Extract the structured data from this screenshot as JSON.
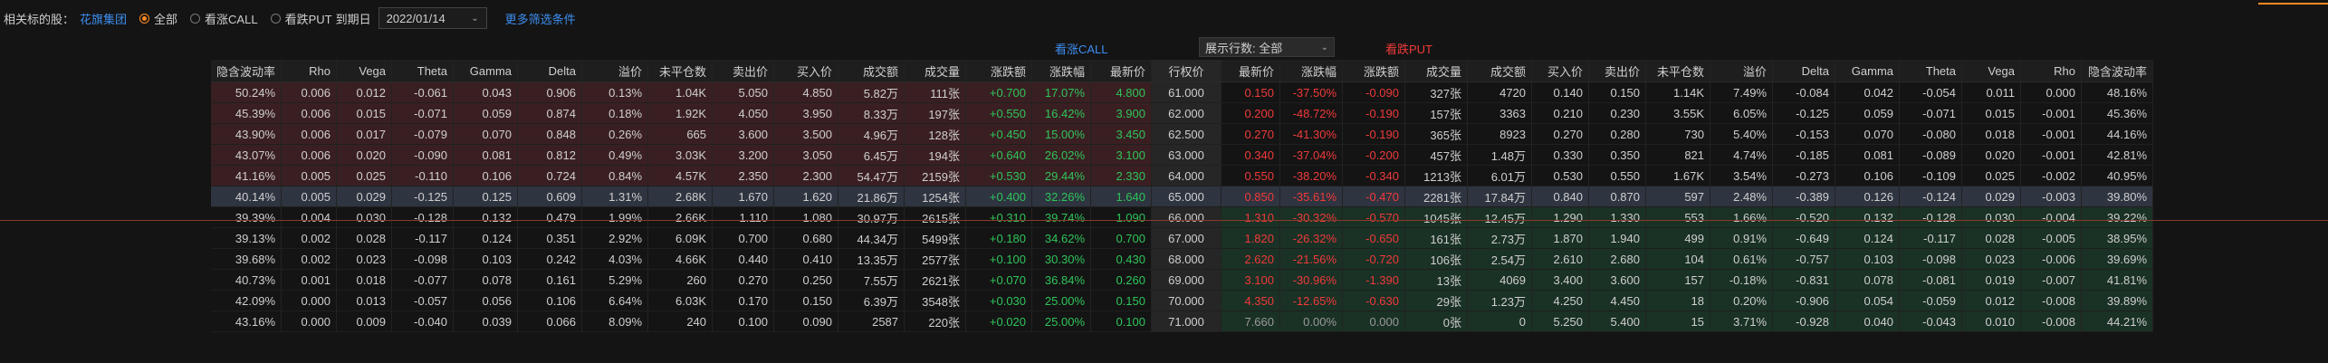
{
  "toolbar": {
    "underlying_label": "相关标的股：",
    "underlying_name": "花旗集团",
    "radios": [
      {
        "label": "全部",
        "selected": true
      },
      {
        "label": "看涨CALL",
        "selected": false
      },
      {
        "label": "看跌PUT",
        "selected": false
      }
    ],
    "expiry_label": "到期日",
    "expiry_value": "2022/01/14",
    "more_filters": "更多筛选条件"
  },
  "band": {
    "call_title": "看涨CALL",
    "put_title": "看跌PUT",
    "rowcount_label": "展示行数: 全部"
  },
  "colors": {
    "accent": "#ff8a1f",
    "up": "#2fc45a",
    "down": "#ef3a3a",
    "link": "#3d8ef0"
  },
  "headers": {
    "call": [
      "隐含波动率",
      "Rho",
      "Vega",
      "Theta",
      "Gamma",
      "Delta",
      "溢价",
      "未平仓数",
      "卖出价",
      "买入价",
      "成交额",
      "成交量",
      "涨跌额",
      "涨跌幅",
      "最新价"
    ],
    "strike": "行权价",
    "put": [
      "最新价",
      "涨跌幅",
      "涨跌额",
      "成交量",
      "成交额",
      "买入价",
      "卖出价",
      "未平仓数",
      "溢价",
      "Delta",
      "Gamma",
      "Theta",
      "Vega",
      "Rho",
      "隐含波动率"
    ]
  },
  "rows": [
    {
      "zone": "itm-call",
      "strike": "61.000",
      "call": [
        "50.24%",
        "0.006",
        "0.012",
        "-0.061",
        "0.043",
        "0.906",
        "0.13%",
        "1.04K",
        "5.050",
        "4.850",
        "5.82万",
        "111张",
        "+0.700",
        "17.07%",
        "4.800"
      ],
      "put": [
        "0.150",
        "-37.50%",
        "-0.090",
        "327张",
        "4720",
        "0.140",
        "0.150",
        "1.14K",
        "7.49%",
        "-0.084",
        "0.042",
        "-0.054",
        "0.011",
        "0.000",
        "48.16%"
      ]
    },
    {
      "zone": "itm-call",
      "strike": "62.000",
      "call": [
        "45.39%",
        "0.006",
        "0.015",
        "-0.071",
        "0.059",
        "0.874",
        "0.18%",
        "1.92K",
        "4.050",
        "3.950",
        "8.33万",
        "197张",
        "+0.550",
        "16.42%",
        "3.900"
      ],
      "put": [
        "0.200",
        "-48.72%",
        "-0.190",
        "157张",
        "3363",
        "0.210",
        "0.230",
        "3.55K",
        "6.05%",
        "-0.125",
        "0.059",
        "-0.071",
        "0.015",
        "-0.001",
        "45.36%"
      ]
    },
    {
      "zone": "itm-call",
      "strike": "62.500",
      "call": [
        "43.90%",
        "0.006",
        "0.017",
        "-0.079",
        "0.070",
        "0.848",
        "0.26%",
        "665",
        "3.600",
        "3.500",
        "4.96万",
        "128张",
        "+0.450",
        "15.00%",
        "3.450"
      ],
      "put": [
        "0.270",
        "-41.30%",
        "-0.190",
        "365张",
        "8923",
        "0.270",
        "0.280",
        "730",
        "5.40%",
        "-0.153",
        "0.070",
        "-0.080",
        "0.018",
        "-0.001",
        "44.16%"
      ]
    },
    {
      "zone": "itm-call",
      "strike": "63.000",
      "call": [
        "43.07%",
        "0.006",
        "0.020",
        "-0.090",
        "0.081",
        "0.812",
        "0.49%",
        "3.03K",
        "3.200",
        "3.050",
        "6.45万",
        "194张",
        "+0.640",
        "26.02%",
        "3.100"
      ],
      "put": [
        "0.340",
        "-37.04%",
        "-0.200",
        "457张",
        "1.48万",
        "0.330",
        "0.350",
        "821",
        "4.74%",
        "-0.185",
        "0.081",
        "-0.089",
        "0.020",
        "-0.001",
        "42.81%"
      ]
    },
    {
      "zone": "itm-call",
      "strike": "64.000",
      "call": [
        "41.16%",
        "0.005",
        "0.025",
        "-0.110",
        "0.106",
        "0.724",
        "0.84%",
        "4.57K",
        "2.350",
        "2.300",
        "54.47万",
        "2159张",
        "+0.530",
        "29.44%",
        "2.330"
      ],
      "put": [
        "0.550",
        "-38.20%",
        "-0.340",
        "1213张",
        "6.01万",
        "0.530",
        "0.550",
        "1.67K",
        "3.54%",
        "-0.273",
        "0.106",
        "-0.109",
        "0.025",
        "-0.002",
        "40.95%"
      ]
    },
    {
      "zone": "atm",
      "strike": "65.000",
      "call": [
        "40.14%",
        "0.005",
        "0.029",
        "-0.125",
        "0.125",
        "0.609",
        "1.31%",
        "2.68K",
        "1.670",
        "1.620",
        "21.86万",
        "1254张",
        "+0.400",
        "32.26%",
        "1.640"
      ],
      "put": [
        "0.850",
        "-35.61%",
        "-0.470",
        "2281张",
        "17.84万",
        "0.840",
        "0.870",
        "597",
        "2.48%",
        "-0.389",
        "0.126",
        "-0.124",
        "0.029",
        "-0.003",
        "39.80%"
      ]
    },
    {
      "zone": "itm-put",
      "strike": "66.000",
      "call": [
        "39.39%",
        "0.004",
        "0.030",
        "-0.128",
        "0.132",
        "0.479",
        "1.99%",
        "2.66K",
        "1.110",
        "1.080",
        "30.97万",
        "2615张",
        "+0.310",
        "39.74%",
        "1.090"
      ],
      "put": [
        "1.310",
        "-30.32%",
        "-0.570",
        "1045张",
        "12.45万",
        "1.290",
        "1.330",
        "553",
        "1.66%",
        "-0.520",
        "0.132",
        "-0.128",
        "0.030",
        "-0.004",
        "39.22%"
      ]
    },
    {
      "zone": "itm-put",
      "strike": "67.000",
      "call": [
        "39.13%",
        "0.002",
        "0.028",
        "-0.117",
        "0.124",
        "0.351",
        "2.92%",
        "6.09K",
        "0.700",
        "0.680",
        "44.34万",
        "5499张",
        "+0.180",
        "34.62%",
        "0.700"
      ],
      "put": [
        "1.820",
        "-26.32%",
        "-0.650",
        "161张",
        "2.73万",
        "1.870",
        "1.940",
        "499",
        "0.91%",
        "-0.649",
        "0.124",
        "-0.117",
        "0.028",
        "-0.005",
        "38.95%"
      ]
    },
    {
      "zone": "itm-put",
      "strike": "68.000",
      "call": [
        "39.68%",
        "0.002",
        "0.023",
        "-0.098",
        "0.103",
        "0.242",
        "4.03%",
        "4.66K",
        "0.440",
        "0.410",
        "13.35万",
        "2577张",
        "+0.100",
        "30.30%",
        "0.430"
      ],
      "put": [
        "2.620",
        "-21.56%",
        "-0.720",
        "106张",
        "2.54万",
        "2.610",
        "2.680",
        "104",
        "0.61%",
        "-0.757",
        "0.103",
        "-0.098",
        "0.023",
        "-0.006",
        "39.69%"
      ]
    },
    {
      "zone": "itm-put",
      "strike": "69.000",
      "call": [
        "40.73%",
        "0.001",
        "0.018",
        "-0.077",
        "0.078",
        "0.161",
        "5.29%",
        "260",
        "0.270",
        "0.250",
        "7.55万",
        "2621张",
        "+0.070",
        "36.84%",
        "0.260"
      ],
      "put": [
        "3.100",
        "-30.96%",
        "-1.390",
        "13张",
        "4069",
        "3.400",
        "3.600",
        "157",
        "-0.18%",
        "-0.831",
        "0.078",
        "-0.081",
        "0.019",
        "-0.007",
        "41.81%"
      ]
    },
    {
      "zone": "itm-put",
      "strike": "70.000",
      "call": [
        "42.09%",
        "0.000",
        "0.013",
        "-0.057",
        "0.056",
        "0.106",
        "6.64%",
        "6.03K",
        "0.170",
        "0.150",
        "6.39万",
        "3548张",
        "+0.030",
        "25.00%",
        "0.150"
      ],
      "put": [
        "4.350",
        "-12.65%",
        "-0.630",
        "29张",
        "1.23万",
        "4.250",
        "4.450",
        "18",
        "0.20%",
        "-0.906",
        "0.054",
        "-0.059",
        "0.012",
        "-0.008",
        "39.89%"
      ]
    },
    {
      "zone": "itm-put",
      "strike": "71.000",
      "call": [
        "43.16%",
        "0.000",
        "0.009",
        "-0.040",
        "0.039",
        "0.066",
        "8.09%",
        "240",
        "0.100",
        "0.090",
        "2587",
        "220张",
        "+0.020",
        "25.00%",
        "0.100"
      ],
      "put": [
        "7.660",
        "0.00%",
        "0.000",
        "0张",
        "0",
        "5.250",
        "5.400",
        "15",
        "3.71%",
        "-0.928",
        "0.040",
        "-0.043",
        "0.010",
        "-0.008",
        "44.21%"
      ]
    }
  ]
}
